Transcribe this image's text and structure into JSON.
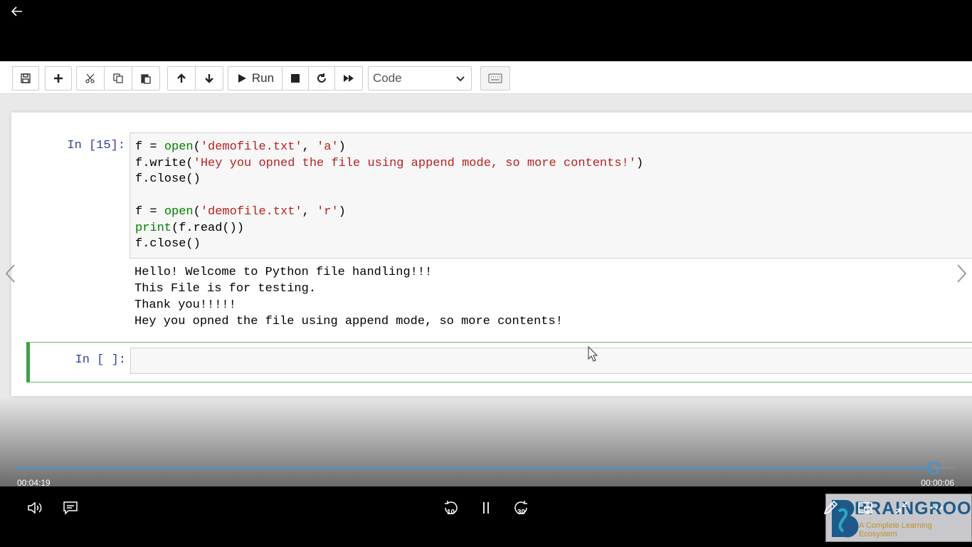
{
  "toolbar": {
    "run_label": "Run",
    "cell_type": "Code"
  },
  "cells": [
    {
      "prompt": "In [15]:",
      "code_lines": [
        "f = open('demofile.txt', 'a')",
        "f.write('Hey you opned the file using append mode, so more contents!')",
        "f.close()",
        "",
        "f = open('demofile.txt', 'r')",
        "print(f.read())",
        "f.close()"
      ],
      "output_lines": [
        "Hello! Welcome to Python file handling!!!",
        "This File is for testing.",
        "Thank you!!!!!",
        "Hey you opned the file using append mode, so more contents!"
      ]
    },
    {
      "prompt": "In [ ]:"
    }
  ],
  "player": {
    "elapsed": "00:04:19",
    "remaining": "00:00:06",
    "progress_fraction": 0.977,
    "rewind_seconds": "10",
    "forward_seconds": "30",
    "accent_color": "#3a96dd"
  },
  "watermark": {
    "name": "BRAINGROOM",
    "tagline": "A Complete Learning Ecosystem"
  },
  "icons": [
    "back-arrow-icon",
    "save-icon",
    "plus-icon",
    "cut-icon",
    "copy-icon",
    "paste-icon",
    "arrow-up-icon",
    "arrow-down-icon",
    "play-icon",
    "stop-icon",
    "restart-icon",
    "fast-forward-icon",
    "keyboard-icon",
    "chevron-down-icon",
    "volume-icon",
    "subtitles-icon",
    "rewind-10-icon",
    "pause-icon",
    "forward-30-icon",
    "pen-icon",
    "miniview-icon",
    "exit-fullscreen-icon",
    "more-icon"
  ]
}
